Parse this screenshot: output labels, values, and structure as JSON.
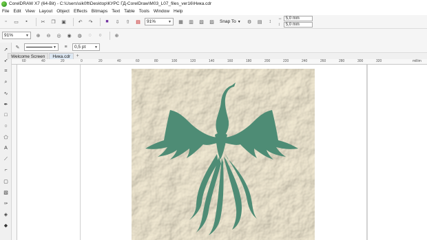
{
  "window": {
    "title": "CorelDRAW X7 (64-Bit) - C:\\Users\\sik0ft\\Desktop\\КУРС ГД-CorelDraw\\M03_L07_files_ver16\\Ника.cdr"
  },
  "menu": [
    "File",
    "Edit",
    "View",
    "Layout",
    "Object",
    "Effects",
    "Bitmaps",
    "Text",
    "Table",
    "Tools",
    "Window",
    "Help"
  ],
  "standard_bar": {
    "zoom_value": "91%",
    "snap_to_label": "Snap To",
    "width_value": "5,0 mm",
    "height_value": "5,0 mm"
  },
  "property_bar": {
    "zoom_value": "91%"
  },
  "outline_bar": {
    "outline_width": "0,5 pt"
  },
  "tabs": [
    "Welcome Screen",
    "Ника.cdr"
  ],
  "ruler": {
    "labels": [
      "60",
      "40",
      "20",
      "0",
      "20",
      "40",
      "60",
      "80",
      "100",
      "120",
      "140",
      "160",
      "180",
      "200",
      "220",
      "240",
      "260",
      "280",
      "300",
      "320"
    ],
    "unit": "millim"
  },
  "colors": {
    "bird": "#4e8c75",
    "paper": "#ede4cc",
    "accent": "#1f8a1f"
  }
}
